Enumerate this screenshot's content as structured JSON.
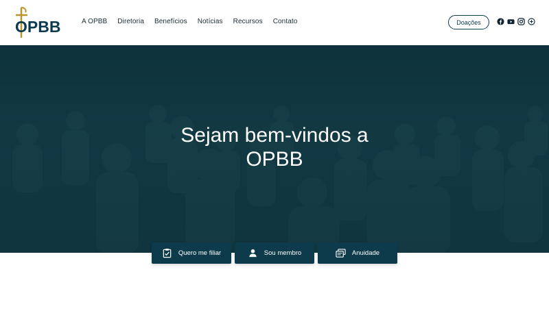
{
  "header": {
    "logo_text": "OPBB",
    "nav": [
      {
        "label": "A OPBB"
      },
      {
        "label": "Diretoria"
      },
      {
        "label": "Benefícios"
      },
      {
        "label": "Notícias"
      },
      {
        "label": "Recursos"
      },
      {
        "label": "Contato"
      }
    ],
    "donate_label": "Doações",
    "social": [
      "facebook-icon",
      "youtube-icon",
      "instagram-icon",
      "plus-circle-icon"
    ]
  },
  "hero": {
    "title_line1": "Sejam bem-vindos a",
    "title_line2": "OPBB"
  },
  "actions": [
    {
      "label": "Quero me filiar",
      "icon": "clipboard-check-icon"
    },
    {
      "label": "Sou membro",
      "icon": "user-icon"
    },
    {
      "label": "Anuidade",
      "icon": "stacked-cards-icon"
    }
  ],
  "colors": {
    "brand": "#0d3b4c",
    "gold": "#b8952e"
  }
}
